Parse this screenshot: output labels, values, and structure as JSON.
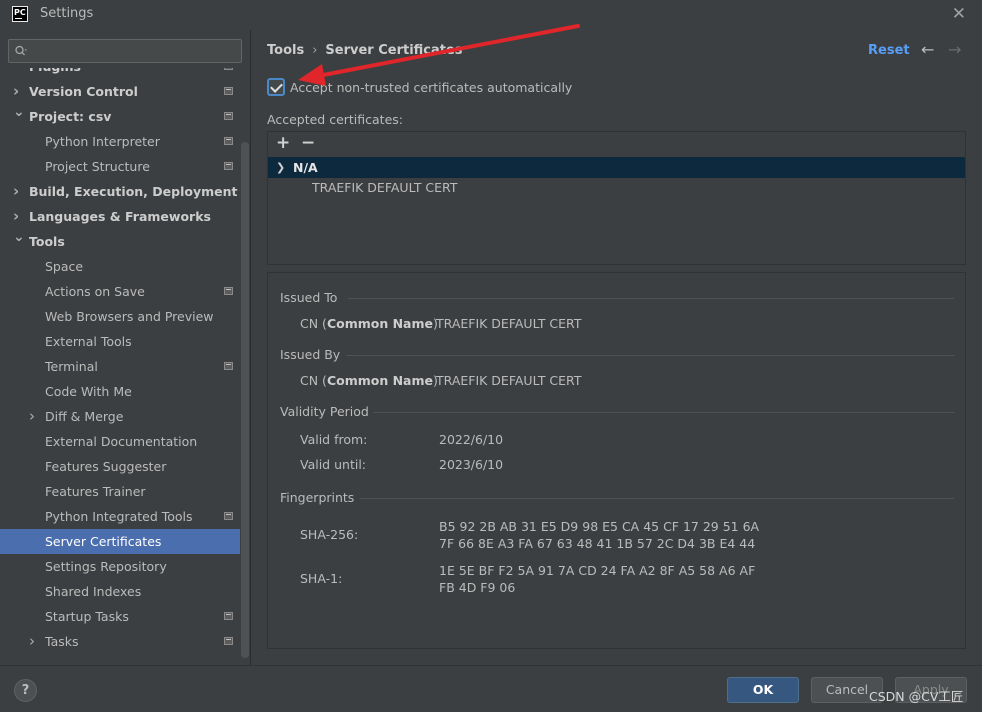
{
  "window": {
    "title": "Settings",
    "app_icon_text": "PC"
  },
  "sidebar": {
    "search_placeholder": "",
    "items": [
      {
        "label": "Plugins",
        "bold": true,
        "chevron": "",
        "indent": 1,
        "proj_icon": true
      },
      {
        "label": "Version Control",
        "bold": true,
        "chevron": "right",
        "indent": 1,
        "proj_icon": true
      },
      {
        "label": "Project: csv",
        "bold": true,
        "chevron": "down",
        "indent": 1,
        "proj_icon": true
      },
      {
        "label": "Python Interpreter",
        "bold": false,
        "chevron": "",
        "indent": 2,
        "proj_icon": true
      },
      {
        "label": "Project Structure",
        "bold": false,
        "chevron": "",
        "indent": 2,
        "proj_icon": true
      },
      {
        "label": "Build, Execution, Deployment",
        "bold": true,
        "chevron": "right",
        "indent": 1,
        "proj_icon": false
      },
      {
        "label": "Languages & Frameworks",
        "bold": true,
        "chevron": "right",
        "indent": 1,
        "proj_icon": false
      },
      {
        "label": "Tools",
        "bold": true,
        "chevron": "down",
        "indent": 1,
        "proj_icon": false
      },
      {
        "label": "Space",
        "bold": false,
        "chevron": "",
        "indent": 2,
        "proj_icon": false
      },
      {
        "label": "Actions on Save",
        "bold": false,
        "chevron": "",
        "indent": 2,
        "proj_icon": true
      },
      {
        "label": "Web Browsers and Preview",
        "bold": false,
        "chevron": "",
        "indent": 2,
        "proj_icon": false
      },
      {
        "label": "External Tools",
        "bold": false,
        "chevron": "",
        "indent": 2,
        "proj_icon": false
      },
      {
        "label": "Terminal",
        "bold": false,
        "chevron": "",
        "indent": 2,
        "proj_icon": true
      },
      {
        "label": "Code With Me",
        "bold": false,
        "chevron": "",
        "indent": 2,
        "proj_icon": false
      },
      {
        "label": "Diff & Merge",
        "bold": false,
        "chevron": "right",
        "indent": 2,
        "proj_icon": false
      },
      {
        "label": "External Documentation",
        "bold": false,
        "chevron": "",
        "indent": 2,
        "proj_icon": false
      },
      {
        "label": "Features Suggester",
        "bold": false,
        "chevron": "",
        "indent": 2,
        "proj_icon": false
      },
      {
        "label": "Features Trainer",
        "bold": false,
        "chevron": "",
        "indent": 2,
        "proj_icon": false
      },
      {
        "label": "Python Integrated Tools",
        "bold": false,
        "chevron": "",
        "indent": 2,
        "proj_icon": true
      },
      {
        "label": "Server Certificates",
        "bold": false,
        "chevron": "",
        "indent": 2,
        "proj_icon": false,
        "selected": true
      },
      {
        "label": "Settings Repository",
        "bold": false,
        "chevron": "",
        "indent": 2,
        "proj_icon": false
      },
      {
        "label": "Shared Indexes",
        "bold": false,
        "chevron": "",
        "indent": 2,
        "proj_icon": false
      },
      {
        "label": "Startup Tasks",
        "bold": false,
        "chevron": "",
        "indent": 2,
        "proj_icon": true
      },
      {
        "label": "Tasks",
        "bold": false,
        "chevron": "right",
        "indent": 2,
        "proj_icon": true
      }
    ]
  },
  "header": {
    "breadcrumb_parent": "Tools",
    "breadcrumb_sep": "›",
    "breadcrumb_current": "Server Certificates",
    "reset_label": "Reset",
    "back_icon": "←",
    "forward_icon": "→"
  },
  "settings": {
    "accept_checkbox_label": "Accept non-trusted certificates automatically",
    "accept_checked": true,
    "accepted_label": "Accepted certificates:"
  },
  "cert_list": {
    "add_icon": "+",
    "remove_icon": "−",
    "group_label": "N/A",
    "cert_name": "TRAEFIK DEFAULT CERT"
  },
  "details": {
    "issued_to": {
      "title": "Issued To",
      "key_prefix": "CN (",
      "key_bold": "Common Name",
      "key_suffix": ")",
      "value": "TRAEFIK DEFAULT CERT"
    },
    "issued_by": {
      "title": "Issued By",
      "key_prefix": "CN (",
      "key_bold": "Common Name",
      "key_suffix": ")",
      "value": "TRAEFIK DEFAULT CERT"
    },
    "validity": {
      "title": "Validity Period",
      "from_label": "Valid from:",
      "from_value": "2022/6/10",
      "until_label": "Valid until:",
      "until_value": "2023/6/10"
    },
    "fingerprints": {
      "title": "Fingerprints",
      "sha256_label": "SHA-256:",
      "sha256_line1": "B5 92 2B AB 31 E5 D9 98 E5 CA 45 CF 17 29 51 6A",
      "sha256_line2": "7F 66 8E A3 FA 67 63 48 41 1B 57 2C D4 3B E4 44",
      "sha1_label": "SHA-1:",
      "sha1_line1": "1E 5E BF F2 5A 91 7A CD 24 FA A2 8F A5 58 A6 AF",
      "sha1_line2": "FB 4D F9 06"
    }
  },
  "footer": {
    "help_label": "?",
    "ok_label": "OK",
    "cancel_label": "Cancel",
    "apply_label": "Apply",
    "watermark": "CSDN @CV工匠"
  },
  "colors": {
    "background": "#3c3f41",
    "selection": "#4b6eaf",
    "accent_link": "#589df6",
    "ok_button": "#365880",
    "annotation_arrow": "#e0262b",
    "tree_selection_dark": "#0d293e"
  }
}
